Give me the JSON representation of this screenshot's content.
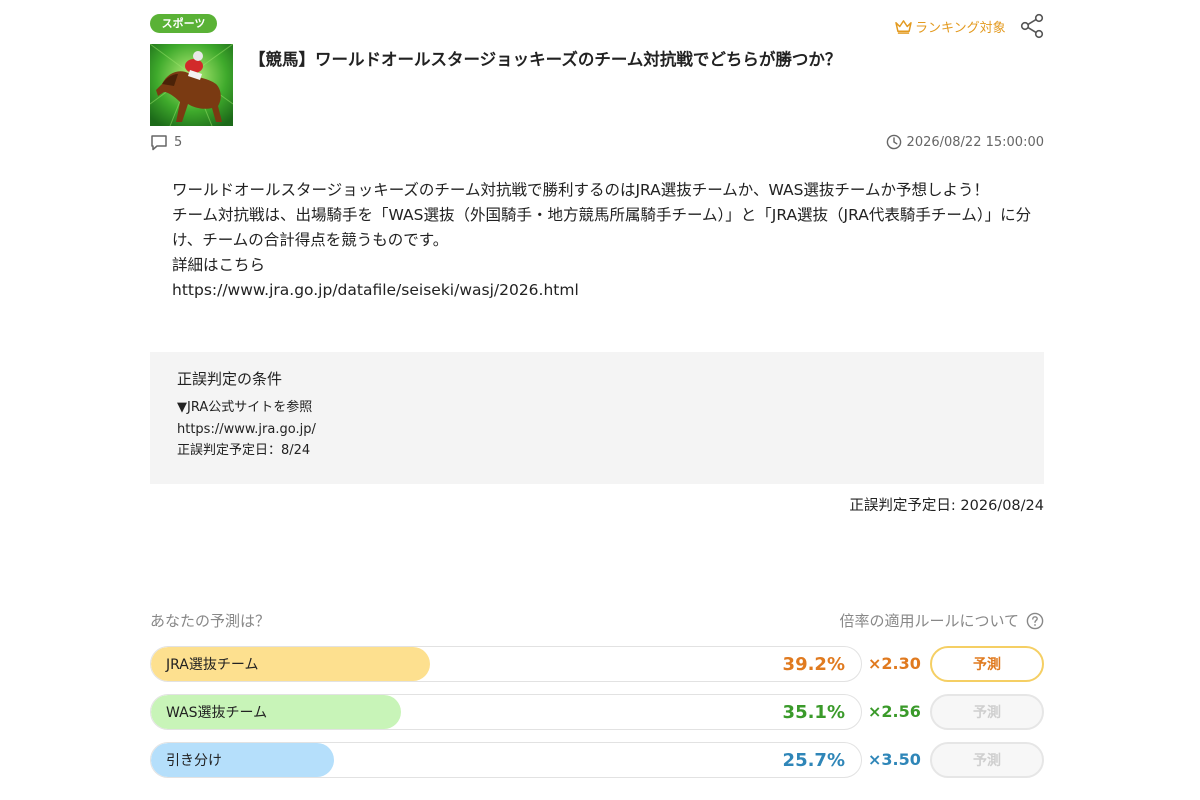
{
  "category": "スポーツ",
  "ranking_label": "ランキング対象",
  "title": "【競馬】ワールドオールスタージョッキーズのチーム対抗戦でどちらが勝つか？",
  "comment_count": "5",
  "datetime": "2026/08/22 15:00:00",
  "description": {
    "p1": "ワールドオールスタージョッキーズのチーム対抗戦で勝利するのはJRA選抜チームか、WAS選抜チームか予想しよう！",
    "p2": "チーム対抗戦は、出場騎手を「WAS選抜（外国騎手・地方競馬所属騎手チーム）」と「JRA選抜（JRA代表騎手チーム）」に分け、チームの合計得点を競うものです。",
    "p3": "詳細はこちら",
    "p4": "https://www.jra.go.jp/datafile/seiseki/wasj/2026.html"
  },
  "conditions": {
    "title": "正誤判定の条件",
    "line1": "▼JRA公式サイトを参照",
    "line2": "https://www.jra.go.jp/",
    "line3": "正誤判定予定日：8/24"
  },
  "judge_date": "正誤判定予定日: 2026/08/24",
  "predict_label": "あなたの予測は？",
  "rule_link": "倍率の適用ルールについて",
  "options": [
    {
      "label": "JRA選抜チーム",
      "percent": 39.2,
      "percent_text": "39.2%",
      "odds": "×2.30",
      "button": "予測",
      "bar_color": "#fde08f",
      "text_color": "#e07a1f"
    },
    {
      "label": "WAS選抜チーム",
      "percent": 35.1,
      "percent_text": "35.1%",
      "odds": "×2.56",
      "button": "予測",
      "bar_color": "#c8f4b8",
      "text_color": "#3a9a2a"
    },
    {
      "label": "引き分け",
      "percent": 25.7,
      "percent_text": "25.7%",
      "odds": "×3.50",
      "button": "予測",
      "bar_color": "#b5dffb",
      "text_color": "#2f86b8"
    }
  ]
}
